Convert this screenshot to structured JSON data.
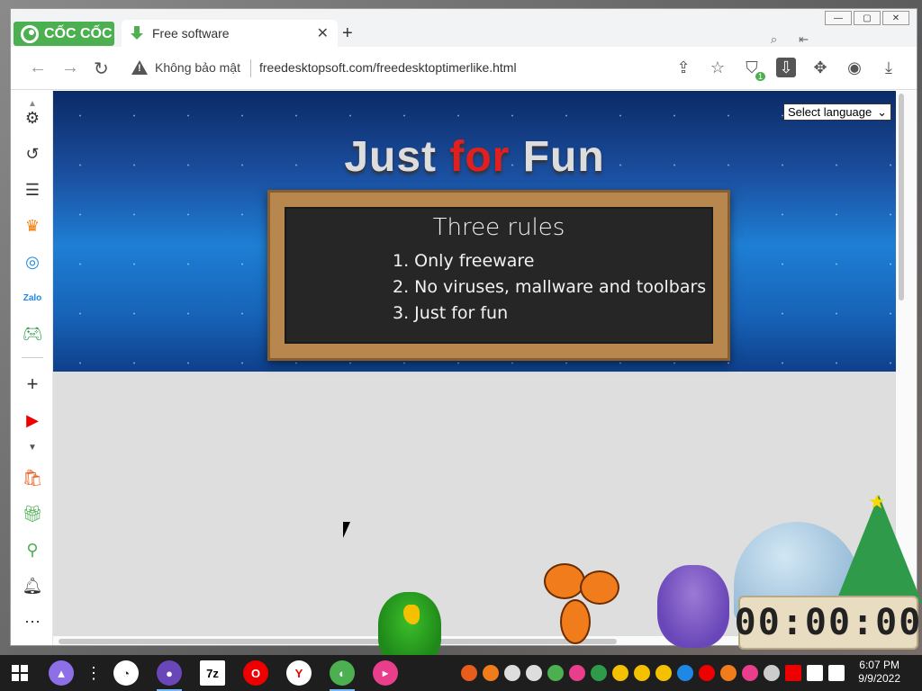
{
  "browser": {
    "brand": "CỐC CỐC",
    "tab_title": "Free software",
    "tab_close": "✕",
    "new_tab": "+",
    "security_label": "Không bảo mật",
    "url": "freedesktopsoft.com/freedesktoptimerlike.html",
    "extension_badge": "1"
  },
  "page": {
    "hero_title_1": "Just ",
    "hero_title_2": "for",
    "hero_title_3": " Fun",
    "board_title": "Three rules",
    "rules": [
      "1. Only freeware",
      "2. No viruses, mallware and toolbars",
      "3. Just for fun"
    ],
    "language_select": "Select language"
  },
  "timer": {
    "display": "00:00:00"
  },
  "taskbar": {
    "time": "6:07 PM",
    "date": "9/9/2022",
    "app_7z": "7z"
  },
  "colors": {
    "accent_green": "#4caf50",
    "hero_red": "#e02020"
  }
}
